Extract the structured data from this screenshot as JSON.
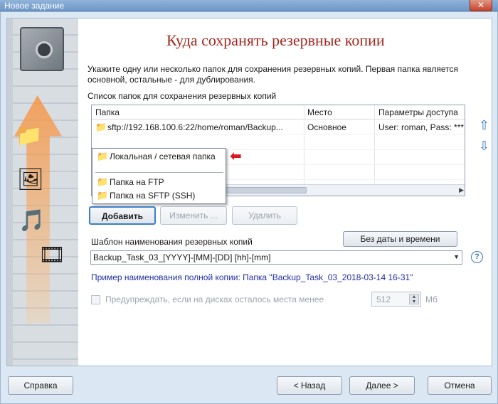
{
  "window": {
    "title": "Новое задание",
    "close_glyph": "✕"
  },
  "page": {
    "heading": "Куда сохранять резервные копии",
    "description": "Укажите одну или несколько папок для сохранения резервных копий. Первая папка является основной, остальные - для дублирования.",
    "list_label": "Список папок для сохранения резервных копий"
  },
  "table": {
    "columns": [
      "Папка",
      "Место",
      "Параметры доступа"
    ],
    "rows": [
      {
        "folder": "sftp://192.168.100.6:22/home/roman/Backup...",
        "place": "Основное",
        "access": "User: roman, Pass: ***"
      }
    ]
  },
  "popup_menu": {
    "items": [
      {
        "label": "Локальная / сетевая папка",
        "icon": "folder-icon"
      },
      {
        "label": "Папка на FTP",
        "icon": "ftp-folder-icon"
      },
      {
        "label": "Папка на SFTP (SSH)",
        "icon": "sftp-folder-icon"
      }
    ]
  },
  "list_buttons": {
    "add": "Добавить",
    "edit": "Изменить ...",
    "delete": "Удалить"
  },
  "template": {
    "label": "Шаблон наименования резервных копий",
    "no_date_button": "Без даты и времени",
    "value": "Backup_Task_03_[YYYY]-[MM]-[DD] [hh]-[mm]",
    "help": "?",
    "example": "Пример наименования полной копии: Папка \"Backup_Task_03_2018-03-14 16-31\""
  },
  "warn": {
    "label": "Предупреждать, если на дисках осталось места менее",
    "value": "512",
    "unit": "Мб",
    "checked": false
  },
  "footer": {
    "help": "Справка",
    "back": "< Назад",
    "next": "Далее >",
    "cancel": "Отмена"
  },
  "colors": {
    "heading": "#a5261d",
    "example_link": "#1f2ea8",
    "accent_border": "#3c7fc4",
    "red_arrow": "#d8191d"
  }
}
